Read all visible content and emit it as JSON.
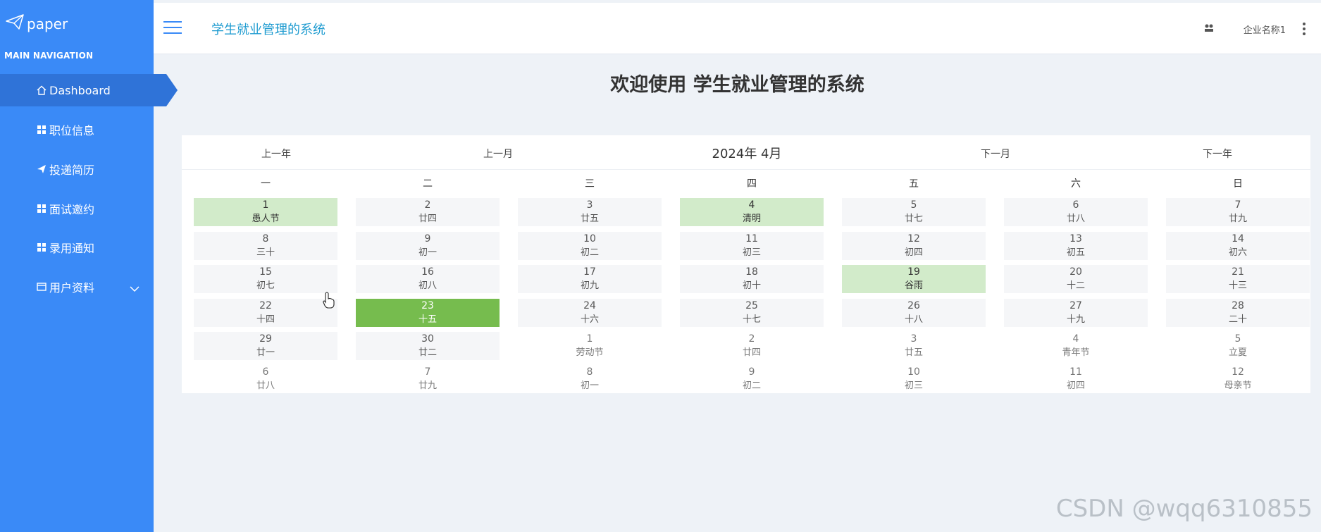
{
  "sidebar": {
    "logo_text": "paper",
    "nav_title": "MAIN NAVIGATION",
    "items": [
      {
        "label": "Dashboard",
        "icon": "home-icon"
      },
      {
        "label": "职位信息",
        "icon": "grid-icon"
      },
      {
        "label": "投递简历",
        "icon": "send-icon"
      },
      {
        "label": "面试邀约",
        "icon": "grid-icon"
      },
      {
        "label": "录用通知",
        "icon": "grid-icon"
      },
      {
        "label": "用户资料",
        "icon": "card-icon"
      }
    ]
  },
  "header": {
    "title": "学生就业管理的系统",
    "company": "企业名称1"
  },
  "main": {
    "welcome": "欢迎使用 学生就业管理的系统"
  },
  "calendar": {
    "prev_year": "上一年",
    "prev_month": "上一月",
    "current": "2024年 4月",
    "next_month": "下一月",
    "next_year": "下一年",
    "weekdays": [
      "一",
      "二",
      "三",
      "四",
      "五",
      "六",
      "日"
    ],
    "weeks": [
      [
        [
          "1",
          "愚人节",
          "festival"
        ],
        [
          "2",
          "廿四",
          ""
        ],
        [
          "3",
          "廿五",
          ""
        ],
        [
          "4",
          "清明",
          "festival"
        ],
        [
          "5",
          "廿七",
          ""
        ],
        [
          "6",
          "廿八",
          ""
        ],
        [
          "7",
          "廿九",
          ""
        ]
      ],
      [
        [
          "8",
          "三十",
          ""
        ],
        [
          "9",
          "初一",
          ""
        ],
        [
          "10",
          "初二",
          ""
        ],
        [
          "11",
          "初三",
          ""
        ],
        [
          "12",
          "初四",
          ""
        ],
        [
          "13",
          "初五",
          ""
        ],
        [
          "14",
          "初六",
          ""
        ]
      ],
      [
        [
          "15",
          "初七",
          ""
        ],
        [
          "16",
          "初八",
          ""
        ],
        [
          "17",
          "初九",
          ""
        ],
        [
          "18",
          "初十",
          ""
        ],
        [
          "19",
          "谷雨",
          "festival"
        ],
        [
          "20",
          "十二",
          ""
        ],
        [
          "21",
          "十三",
          ""
        ]
      ],
      [
        [
          "22",
          "十四",
          ""
        ],
        [
          "23",
          "十五",
          "today"
        ],
        [
          "24",
          "十六",
          ""
        ],
        [
          "25",
          "十七",
          ""
        ],
        [
          "26",
          "十八",
          ""
        ],
        [
          "27",
          "十九",
          ""
        ],
        [
          "28",
          "二十",
          ""
        ]
      ],
      [
        [
          "29",
          "廿一",
          ""
        ],
        [
          "30",
          "廿二",
          ""
        ],
        [
          "1",
          "劳动节",
          "other"
        ],
        [
          "2",
          "廿四",
          "other"
        ],
        [
          "3",
          "廿五",
          "other"
        ],
        [
          "4",
          "青年节",
          "other"
        ],
        [
          "5",
          "立夏",
          "other"
        ]
      ],
      [
        [
          "6",
          "廿八",
          "other"
        ],
        [
          "7",
          "廿九",
          "other"
        ],
        [
          "8",
          "初一",
          "other"
        ],
        [
          "9",
          "初二",
          "other"
        ],
        [
          "10",
          "初三",
          "other"
        ],
        [
          "11",
          "初四",
          "other"
        ],
        [
          "12",
          "母亲节",
          "other"
        ]
      ]
    ]
  },
  "watermark": "CSDN @wqq6310855",
  "colors": {
    "sidebar": "#3a8af7",
    "active_item": "#2f73d8",
    "festival": "#d2ebca",
    "today": "#76bc4e"
  }
}
